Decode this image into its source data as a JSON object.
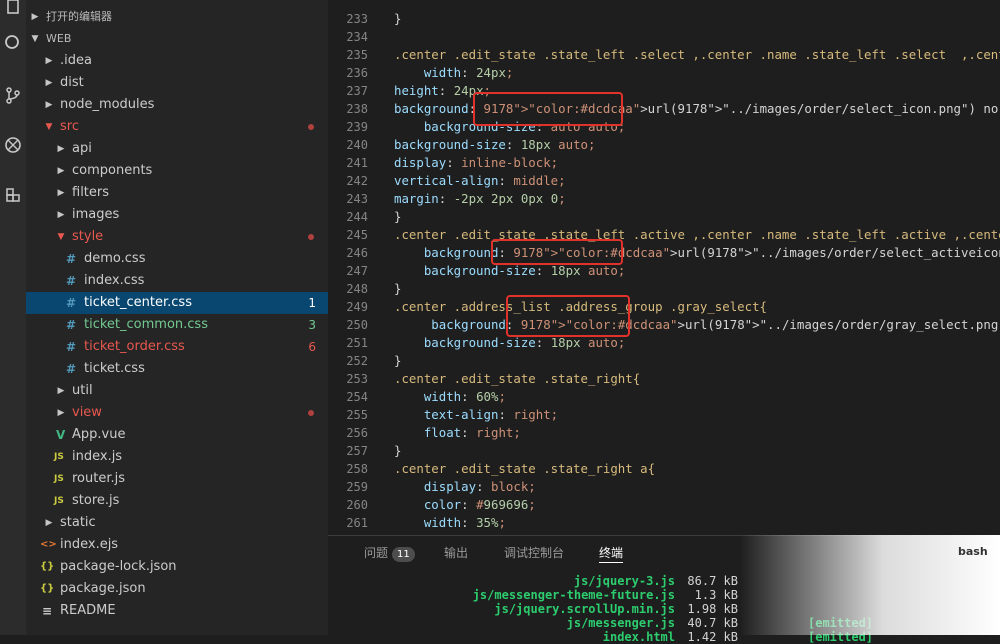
{
  "sidebar": {
    "open_editors": "打开的编辑器",
    "project": "WEB",
    "items": [
      {
        "label": "ticket_center.css"
      }
    ],
    "tree": {
      "idea": ".idea",
      "dist": "dist",
      "node_modules": "node_modules",
      "src": "src",
      "api": "api",
      "components": "components",
      "filters": "filters",
      "images": "images",
      "style": "style",
      "demo_css": "demo.css",
      "index_css": "index.css",
      "ticket_center_css": "ticket_center.css",
      "ticket_center_badge": "1",
      "ticket_common_css": "ticket_common.css",
      "ticket_common_badge": "3",
      "ticket_order_css": "ticket_order.css",
      "ticket_order_badge": "6",
      "ticket_css": "ticket.css",
      "util": "util",
      "view": "view",
      "app_vue": "App.vue",
      "index_js": "index.js",
      "router_js": "router.js",
      "store_js": "store.js",
      "static": "static",
      "index_ejs": "index.ejs",
      "package_lock": "package-lock.json",
      "package_json": "package.json",
      "readme": "README"
    },
    "icons": {
      "css": "#",
      "js": "JS",
      "vue": "V",
      "ejs": "<>",
      "json": "{}",
      "readme": "≡"
    }
  },
  "editor": {
    "line_numbers": [
      "233",
      "234",
      "235",
      "236",
      "237",
      "238",
      "239",
      "240",
      "241",
      "242",
      "243",
      "244",
      "245",
      "246",
      "247",
      "248",
      "249",
      "250",
      "251",
      "252",
      "253",
      "254",
      "255",
      "256",
      "257",
      "258",
      "259",
      "260",
      "261"
    ],
    "lines": [
      "}",
      "",
      ".center .edit_state .state_left .select ,.center .name .state_left .select  ,.center",
      "    width: 24px;",
      "height: 24px;",
      "background: url(\"../images/order/select_icon.png\") no-repeat center left;",
      "    background-size: auto auto;",
      "background-size: 18px auto;",
      "display: inline-block;",
      "vertical-align: middle;",
      "margin: -2px 2px 0px 0;",
      "}",
      ".center .edit_state .state_left .active ,.center .name .state_left .active ,.center",
      "    background: url(\"../images/order/select_activeicon.png\") no-repeat center left;",
      "    background-size: 18px auto;",
      "}",
      ".center .address_list .address_group .gray_select{",
      "     background: url(\"../images/order/gray_select.png\") no-repeat center left;",
      "    background-size: 18px auto;",
      "}",
      ".center .edit_state .state_right{",
      "    width: 60%;",
      "    text-align: right;",
      "    float: right;",
      "}",
      ".center .edit_state .state_right a{",
      "    display: block;",
      "    color: #969696;",
      "    width: 35%;"
    ]
  },
  "panel": {
    "tabs": {
      "problems": "问题",
      "problems_count": "11",
      "output": "输出",
      "debug_console": "调试控制台",
      "terminal": "终端"
    },
    "shell": "bash",
    "terminal_lines": [
      {
        "file": "js/jquery-3.js",
        "size": "86.7 kB",
        "status": ""
      },
      {
        "file": "js/messenger-theme-future.js",
        "size": "1.3 kB",
        "status": ""
      },
      {
        "file": "js/jquery.scrollUp.min.js",
        "size": "1.98 kB",
        "status": ""
      },
      {
        "file": "js/messenger.js",
        "size": "40.7 kB",
        "status": "[emitted]"
      },
      {
        "file": "index.html",
        "size": "1.42 kB",
        "status": "[emitted]"
      }
    ]
  }
}
